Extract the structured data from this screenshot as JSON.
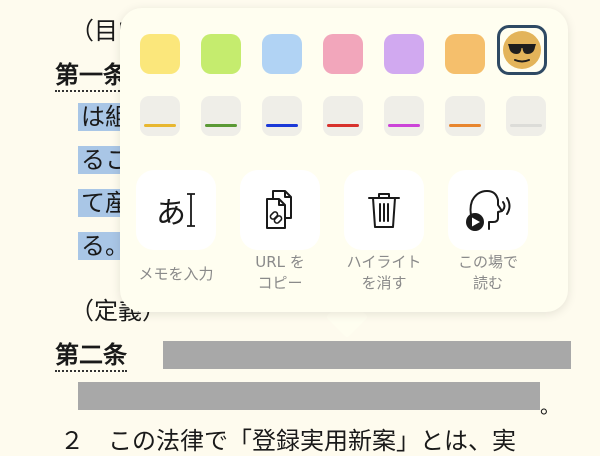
{
  "document": {
    "line1": "（目的",
    "art1_heading": "第一条",
    "art1_line1": "は組",
    "art1_line2": "るこ",
    "art1_line3": "て産",
    "art1_line4": "る。",
    "line_def": "（定義）",
    "art2_heading": "第二条",
    "period_mark": "。",
    "last_line": "２　この法律で「登録実用新案」とは、実"
  },
  "popup": {
    "highlight_colors": [
      "#fbe77b",
      "#c5ec6e",
      "#b1d3f4",
      "#f2a6bb",
      "#d1a9f0",
      "#f5bf6c"
    ],
    "underline_colors": [
      "#e8b730",
      "#5b9a35",
      "#1b39d8",
      "#d8322c",
      "#cc44d8",
      "#e8862e",
      "#dcdcd8"
    ],
    "selected_style": "emoji",
    "actions": [
      {
        "name": "add-memo",
        "label": "メモを入力",
        "icon_text": "あ"
      },
      {
        "name": "copy-url",
        "label": "URL を\nコピー"
      },
      {
        "name": "delete-highlight",
        "label": "ハイライト\nを消す"
      },
      {
        "name": "read-here",
        "label": "この場で\n読む"
      }
    ]
  }
}
